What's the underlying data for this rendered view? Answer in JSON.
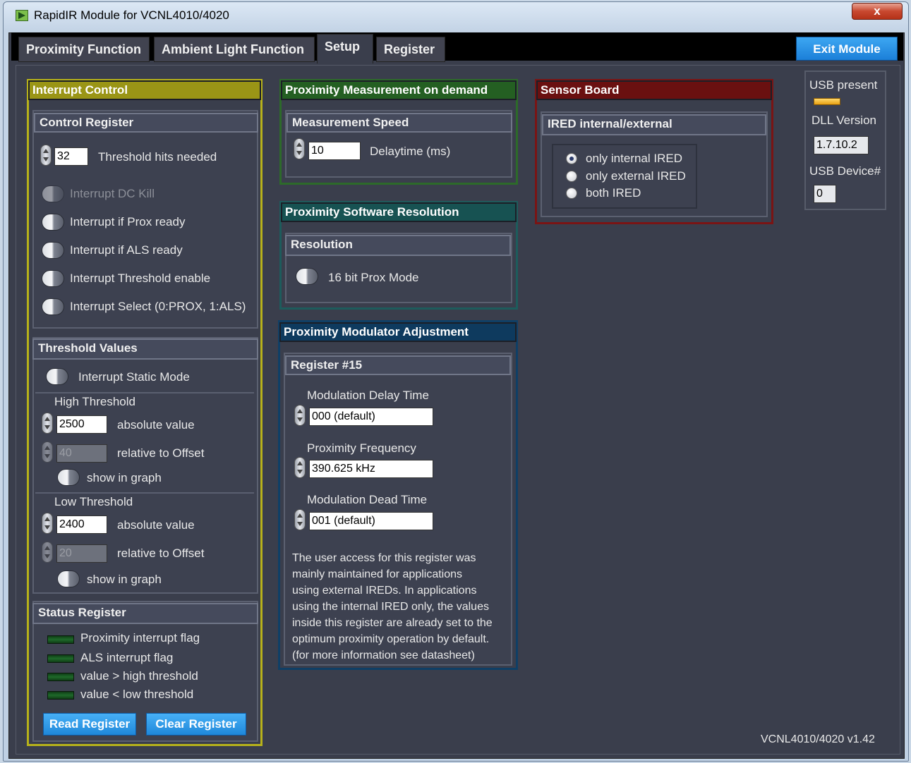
{
  "window": {
    "title": "RapidIR Module for VCNL4010/4020",
    "close_label": "x"
  },
  "tabs": [
    {
      "label": "Proximity Function"
    },
    {
      "label": "Ambient Light Function"
    },
    {
      "label": "Setup"
    },
    {
      "label": "Register"
    }
  ],
  "active_tab": "Setup",
  "exit_button": "Exit Module",
  "interrupt_control": {
    "title": "Interrupt Control",
    "control_register": {
      "title": "Control Register",
      "threshold_hits_value": "32",
      "threshold_hits_label": "Threshold hits needed",
      "toggles": [
        {
          "label": "Interrupt DC Kill",
          "enabled": false
        },
        {
          "label": "Interrupt if Prox ready",
          "enabled": true
        },
        {
          "label": "Interrupt if ALS ready",
          "enabled": true
        },
        {
          "label": "Interrupt Threshold enable",
          "enabled": true
        },
        {
          "label": "Interrupt Select (0:PROX, 1:ALS)",
          "enabled": true
        }
      ]
    },
    "threshold_values": {
      "title": "Threshold Values",
      "static_mode_label": "Interrupt Static Mode",
      "high": {
        "title": "High Threshold",
        "absolute_value": "2500",
        "absolute_label": "absolute value",
        "relative_value": "40",
        "relative_label": "relative to Offset",
        "show_label": "show in graph"
      },
      "low": {
        "title": "Low Threshold",
        "absolute_value": "2400",
        "absolute_label": "absolute value",
        "relative_value": "20",
        "relative_label": "relative to Offset",
        "show_label": "show in graph"
      }
    },
    "status_register": {
      "title": "Status Register",
      "flags": [
        {
          "label": "Proximity interrupt flag"
        },
        {
          "label": "ALS interrupt flag"
        },
        {
          "label": "value > high threshold"
        },
        {
          "label": "value < low threshold"
        }
      ],
      "read_button": "Read Register",
      "clear_button": "Clear Register"
    }
  },
  "prox_on_demand": {
    "title": "Proximity Measurement on demand",
    "speed_title": "Measurement Speed",
    "delay_value": "10",
    "delay_label": "Delaytime (ms)"
  },
  "prox_resolution": {
    "title": "Proximity Software Resolution",
    "sub_title": "Resolution",
    "mode_label": "16 bit Prox Mode"
  },
  "modulator": {
    "title": "Proximity Modulator Adjustment",
    "sub_title": "Register #15",
    "delay_time_label": "Modulation Delay Time",
    "delay_time_value": "000 (default)",
    "frequency_label": "Proximity Frequency",
    "frequency_value": "390.625 kHz",
    "dead_time_label": "Modulation Dead Time",
    "dead_time_value": "001 (default)",
    "note_lines": [
      "The user access for this register was",
      "mainly maintained for applications",
      "using external IREDs. In applications",
      "using the internal IRED only, the values",
      "inside this register are already set to the",
      "optimum proximity operation by default.",
      "(for more information see datasheet)"
    ]
  },
  "sensor_board": {
    "title": "Sensor Board",
    "sub_title": "IRED internal/external",
    "options": [
      {
        "label": "only internal IRED",
        "selected": true
      },
      {
        "label": "only external IRED",
        "selected": false
      },
      {
        "label": "both IRED",
        "selected": false
      }
    ]
  },
  "usb": {
    "present_label": "USB present",
    "dll_label": "DLL Version",
    "dll_value": "1.7.10.2",
    "device_label": "USB Device#",
    "device_value": "0"
  },
  "version": "VCNL4010/4020 v1.42",
  "colors": {
    "interrupt_frame": "#b7b21a",
    "prox_demand_frame": "#2d6a2a",
    "prox_resolution_frame": "#1d5c5c",
    "modulator_frame": "#0f3f66",
    "sensor_frame": "#7a1414",
    "accent_button": "#1f88da"
  }
}
